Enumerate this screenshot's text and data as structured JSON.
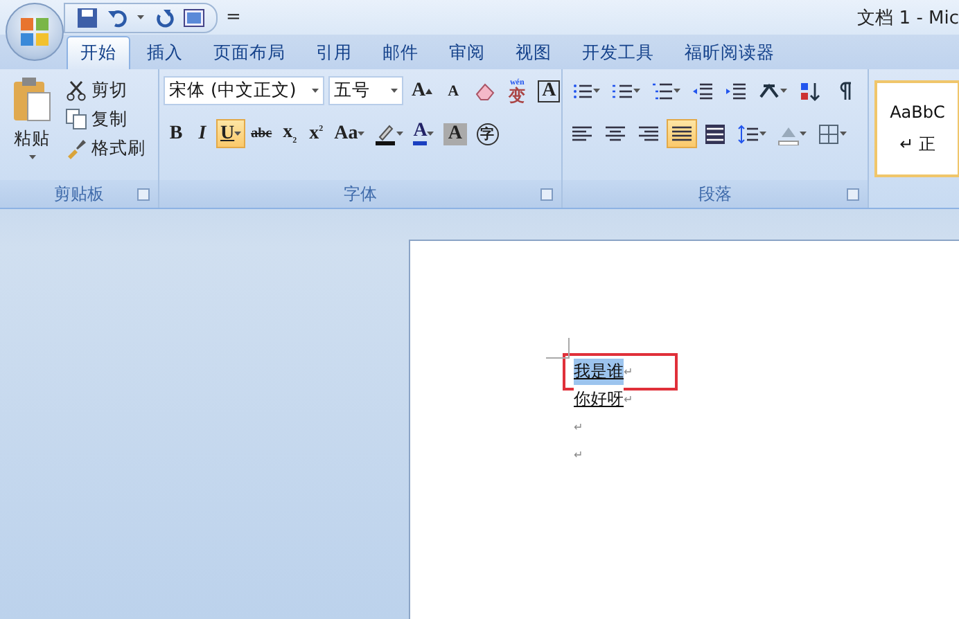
{
  "window": {
    "title": "文档 1 - Mic"
  },
  "quick_access": {
    "separator": "="
  },
  "tabs": [
    {
      "label": "开始",
      "selected": true
    },
    {
      "label": "插入",
      "selected": false
    },
    {
      "label": "页面布局",
      "selected": false
    },
    {
      "label": "引用",
      "selected": false
    },
    {
      "label": "邮件",
      "selected": false
    },
    {
      "label": "审阅",
      "selected": false
    },
    {
      "label": "视图",
      "selected": false
    },
    {
      "label": "开发工具",
      "selected": false
    },
    {
      "label": "福昕阅读器",
      "selected": false
    }
  ],
  "clipboard": {
    "label": "剪贴板",
    "paste": "粘贴",
    "items": [
      {
        "kind": "cut",
        "label": "剪切"
      },
      {
        "kind": "copy",
        "label": "复制"
      },
      {
        "kind": "painter",
        "label": "格式刷"
      }
    ]
  },
  "font": {
    "label": "字体",
    "family": "宋体 (中文正文)",
    "size": "五号",
    "row1": [
      {
        "kind": "grow",
        "label": "A",
        "selected": false
      },
      {
        "kind": "shrink",
        "label": "A",
        "selected": false
      },
      {
        "kind": "clear",
        "selected": false
      },
      {
        "kind": "phonetic",
        "ruby": "wén",
        "label": "变",
        "selected": false
      },
      {
        "kind": "boxed",
        "label": "A",
        "selected": false
      }
    ],
    "row2": [
      {
        "kind": "bold",
        "label": "B",
        "selected": false
      },
      {
        "kind": "italic",
        "label": "I",
        "selected": false
      },
      {
        "kind": "underline",
        "label": "U",
        "selected": true
      },
      {
        "kind": "strike",
        "label": "abc",
        "selected": false
      },
      {
        "kind": "sub",
        "label": "x",
        "index": "2",
        "selected": false
      },
      {
        "kind": "sup",
        "label": "x",
        "index": "2",
        "selected": false
      },
      {
        "kind": "case",
        "label": "Aa",
        "selected": false
      },
      {
        "kind": "highlight",
        "selected": false
      },
      {
        "kind": "color",
        "label": "A",
        "selected": false
      },
      {
        "kind": "shade",
        "label": "A",
        "selected": false
      },
      {
        "kind": "enclose",
        "label": "字",
        "selected": false
      }
    ]
  },
  "paragraph": {
    "label": "段落",
    "row1": [
      {
        "kind": "bullets",
        "selected": false
      },
      {
        "kind": "numbering",
        "selected": false
      },
      {
        "kind": "multilevel",
        "selected": false
      },
      {
        "kind": "outdent",
        "selected": false
      },
      {
        "kind": "indent",
        "selected": false
      },
      {
        "kind": "asian",
        "selected": false
      },
      {
        "kind": "sort",
        "selected": false
      },
      {
        "kind": "marks",
        "selected": false
      }
    ],
    "row2": [
      {
        "kind": "left",
        "selected": false
      },
      {
        "kind": "center",
        "selected": false
      },
      {
        "kind": "right",
        "selected": false
      },
      {
        "kind": "justify",
        "selected": true
      },
      {
        "kind": "distribute",
        "selected": false
      },
      {
        "kind": "spacing",
        "selected": false
      },
      {
        "kind": "fill",
        "selected": false
      },
      {
        "kind": "border",
        "selected": false
      }
    ]
  },
  "styles": {
    "sample": "AaBbC",
    "name": "↵ 正"
  },
  "document": {
    "lines": [
      {
        "text": "我是谁",
        "mark": "↵",
        "selected": true,
        "boxed": true
      },
      {
        "text": "你好呀",
        "mark": "↵",
        "selected": false,
        "boxed": false
      },
      {
        "mark": "↵",
        "boxed": false
      },
      {
        "mark": "↵",
        "boxed": false
      }
    ]
  }
}
